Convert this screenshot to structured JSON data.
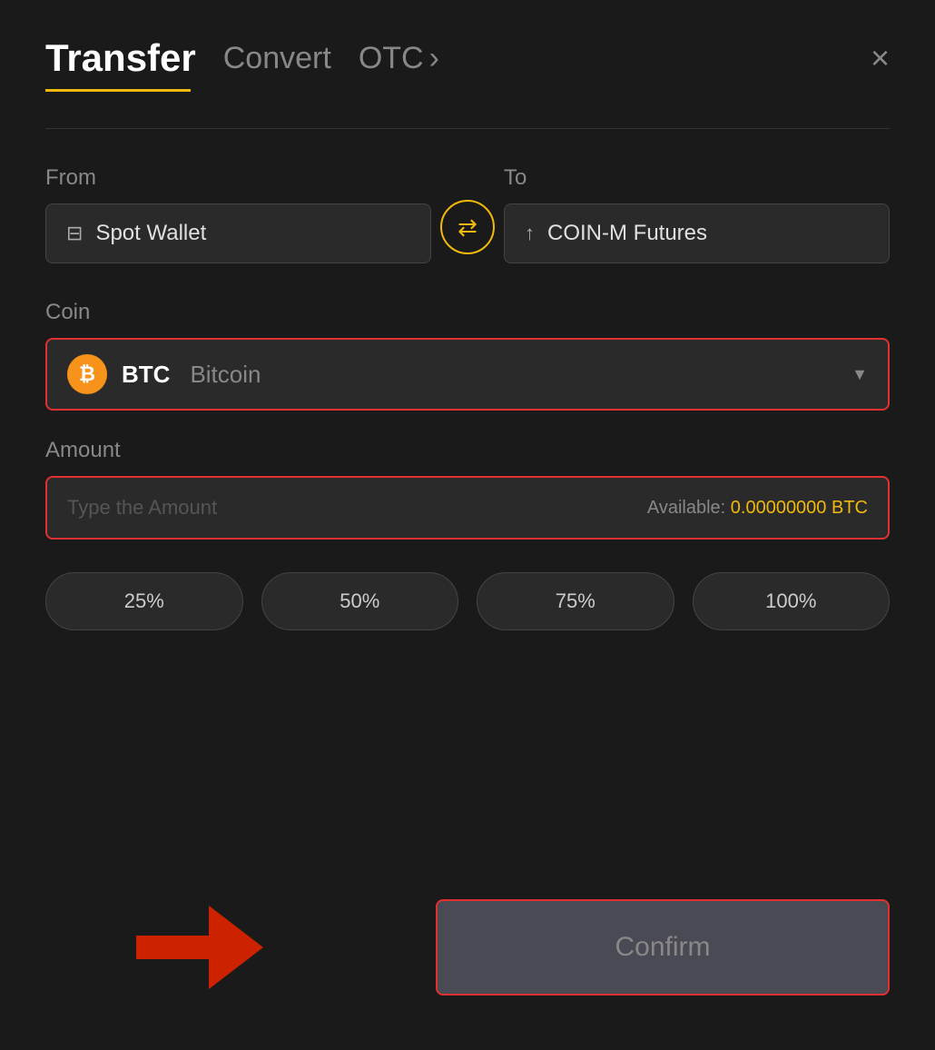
{
  "header": {
    "title": "Transfer",
    "tab_convert": "Convert",
    "tab_otc": "OTC",
    "tab_otc_arrow": "›",
    "close_icon": "×"
  },
  "from": {
    "label": "From",
    "wallet_icon": "▬",
    "wallet_name": "Spot Wallet"
  },
  "swap": {
    "icon": "⇄"
  },
  "to": {
    "label": "To",
    "wallet_icon": "↑",
    "wallet_name": "COIN-M Futures"
  },
  "coin": {
    "label": "Coin",
    "symbol": "BTC",
    "full_name": "Bitcoin",
    "btc_symbol": "₿"
  },
  "amount": {
    "label": "Amount",
    "placeholder": "Type the Amount",
    "available_label": "Available:",
    "available_value": "0.00000000 BTC"
  },
  "percent_buttons": [
    {
      "label": "25%",
      "value": "25"
    },
    {
      "label": "50%",
      "value": "50"
    },
    {
      "label": "75%",
      "value": "75"
    },
    {
      "label": "100%",
      "value": "100"
    }
  ],
  "confirm": {
    "label": "Confirm"
  },
  "colors": {
    "accent": "#f0b90b",
    "border_highlight": "#e03030",
    "bg_dark": "#1a1a1a",
    "bg_input": "#2a2a2a"
  }
}
